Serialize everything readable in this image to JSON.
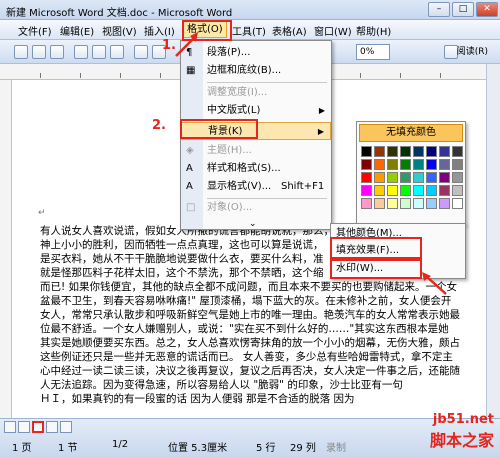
{
  "window": {
    "title": "新建 Microsoft Word 文档.doc - Microsoft Word"
  },
  "menubar": {
    "items": [
      "文件(F)",
      "编辑(E)",
      "视图(V)",
      "插入(I)",
      "格式(O)",
      "工具(T)",
      "表格(A)",
      "窗口(W)",
      "帮助(H)"
    ],
    "active": "格式(O)"
  },
  "toolbar": {
    "zoom": "0%",
    "read_label": "阅读(R)"
  },
  "format_menu": {
    "items": [
      {
        "label": "段落(P)...",
        "icon": "paragraph-icon",
        "disabled": false
      },
      {
        "label": "边框和底纹(B)...",
        "icon": "border-icon",
        "disabled": false
      },
      {
        "label": "调整宽度(I)...",
        "icon": "",
        "disabled": true
      },
      {
        "label": "中文版式(L)",
        "icon": "",
        "disabled": false,
        "submenu": true
      },
      {
        "label": "背景(K)",
        "icon": "",
        "disabled": false,
        "submenu": true,
        "highlighted": true
      },
      {
        "label": "主题(H)...",
        "icon": "theme-icon",
        "disabled": true
      },
      {
        "label": "样式和格式(S)...",
        "icon": "styles-icon",
        "disabled": false
      },
      {
        "label": "显示格式(V)...",
        "icon": "reveal-icon",
        "disabled": false,
        "shortcut": "Shift+F1"
      },
      {
        "label": "对象(O)...",
        "icon": "object-icon",
        "disabled": true
      }
    ]
  },
  "background_palette": {
    "no_fill_label": "无填充颜色",
    "colors": [
      "#000000",
      "#993300",
      "#333300",
      "#003300",
      "#003366",
      "#000080",
      "#333399",
      "#333333",
      "#800000",
      "#FF6600",
      "#808000",
      "#008000",
      "#008080",
      "#0000FF",
      "#666699",
      "#808080",
      "#FF0000",
      "#FF9900",
      "#99CC00",
      "#339966",
      "#33CCCC",
      "#3366FF",
      "#800080",
      "#969696",
      "#FF00FF",
      "#FFCC00",
      "#FFFF00",
      "#00FF00",
      "#00FFFF",
      "#00CCFF",
      "#993366",
      "#C0C0C0",
      "#FF99CC",
      "#FFCC99",
      "#FFFF99",
      "#CCFFCC",
      "#CCFFFF",
      "#99CCFF",
      "#CC99FF",
      "#FFFFFF"
    ],
    "more_items": [
      "其他颜色(M)...",
      "填充效果(F)...",
      "水印(W)..."
    ]
  },
  "annotations": {
    "step1": "1.",
    "step2": "2."
  },
  "document": {
    "lines": [
      "有人说女人喜欢说谎，假如女人所撒的谎言都能胡说就，那么，",
      "神上小小的胜利，因而牺牲一点点真理，这也可以算是说谎，",
      "是买衣料，她从不干干脆脆地说要做什么衣，要买什么料，准",
      "就是怪那匹料子花样太旧，这个不禁洗，那个不禁晒，这个缩",
      "而已! 如果你钱便宜，其他的缺点全都不成问题，而且本来不要买的也要购储起来。一个女",
      "盆最不卫生，到春天容易咻咻痛!\" 屋顶漆桶，塌下蓝大的灰。在未修补之前，女人便会开",
      "女人，常常只承认散步和呼吸新鲜空气是她上市的唯一理由。艳羡汽车的女人常常表示她最",
      "位最不舒适。一个女人嫌赠别人，或说：\"实在买不到什么好的……\"其实这东西根本是她",
      "其实是她顺便要买东西。总之，女人总喜欢愣寄抹角的放一个小小的烟幕，无伤大雅，颇占",
      "这些例证还只是一些并无恶意的谎话而已。    女人善变，多少总有些哈姆雷特式，拿不定主",
      "心中经过一读二读三读，决议之後再复议，复议之后再否决，女人决定一件事之后，还能随",
      "人无法追踪。因为变得急速，所以容易给人以 \"脆弱\" 的印象，沙士比亚有一句",
      "ＨＩ，如果真钓的有一段蜜的话 因为人便弱 那是不合适的脱落 因为"
    ]
  },
  "status": {
    "page": "1 页",
    "section": "1 节",
    "pages": "1/2",
    "position": "位置 5.3厘米",
    "line": "5 行",
    "col": "29 列",
    "rec": "录制"
  },
  "watermark": {
    "site": "jb51.net",
    "name": "脚本之家"
  }
}
